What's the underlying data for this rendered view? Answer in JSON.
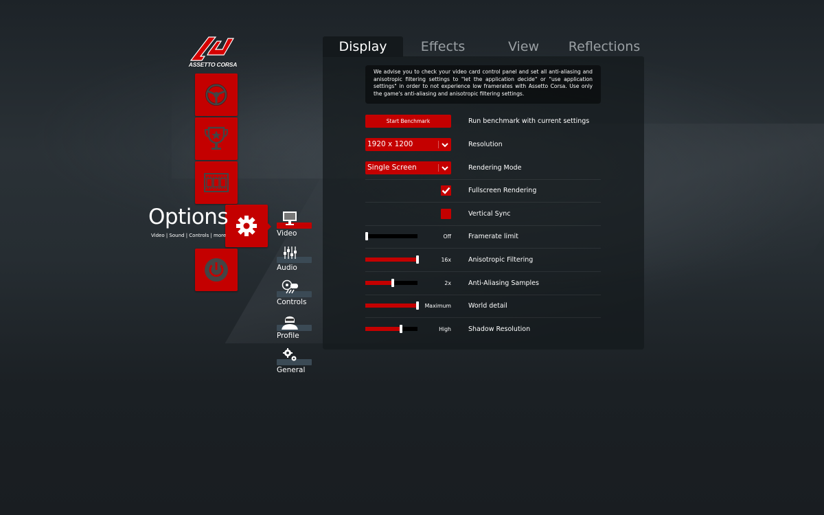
{
  "brand": {
    "name": "ASSETTO CORSA",
    "accent": "#c40000"
  },
  "main_menu": {
    "tiles": [
      {
        "id": "drive",
        "icon": "steering-wheel-icon"
      },
      {
        "id": "special-events",
        "icon": "trophy-icon"
      },
      {
        "id": "replay",
        "icon": "film-icon"
      },
      {
        "id": "options",
        "icon": "gear-icon",
        "active": true
      },
      {
        "id": "quit",
        "icon": "power-icon"
      }
    ],
    "options_title": "Options",
    "options_subtitle": "Video | Sound | Controls | more"
  },
  "options_nav": [
    {
      "label": "Video",
      "icon": "monitor-icon",
      "active": true
    },
    {
      "label": "Audio",
      "icon": "mixer-sliders-icon",
      "active": false
    },
    {
      "label": "Controls",
      "icon": "controls-icon",
      "active": false
    },
    {
      "label": "Profile",
      "icon": "driver-helmet-icon",
      "active": false
    },
    {
      "label": "General",
      "icon": "gears-icon",
      "active": false
    }
  ],
  "tabs": [
    {
      "label": "Display",
      "active": true
    },
    {
      "label": "Effects",
      "active": false
    },
    {
      "label": "View",
      "active": false
    },
    {
      "label": "Reflections",
      "active": false
    }
  ],
  "notice": "We advise you to check your video card control panel and set all anti-aliasing and anisotropic filtering settings to \"let the application decide\" or \"use application settings\" in order to not experience low framerates with Assetto Corsa. Use only the game's anti-aliasing and anisotropic filtering settings.",
  "settings": {
    "benchmark": {
      "button": "Start Benchmark",
      "label": "Run benchmark with current settings"
    },
    "resolution": {
      "value": "1920 x 1200",
      "label": "Resolution"
    },
    "rendering_mode": {
      "value": "Single Screen",
      "label": "Rendering Mode"
    },
    "fullscreen": {
      "checked": true,
      "label": "Fullscreen Rendering"
    },
    "vsync": {
      "checked": false,
      "label": "Vertical Sync"
    },
    "framerate_limit": {
      "value": "Off",
      "level": 0.0,
      "label": "Framerate limit"
    },
    "anisotropic": {
      "value": "16x",
      "level": 1.0,
      "label": "Anisotropic Filtering"
    },
    "antialiasing": {
      "value": "2x",
      "level": 0.52,
      "label": "Anti-Aliasing Samples"
    },
    "world_detail": {
      "value": "Maximum",
      "level": 1.0,
      "label": "World detail"
    },
    "shadow_resolution": {
      "value": "High",
      "level": 0.69,
      "label": "Shadow Resolution"
    }
  }
}
